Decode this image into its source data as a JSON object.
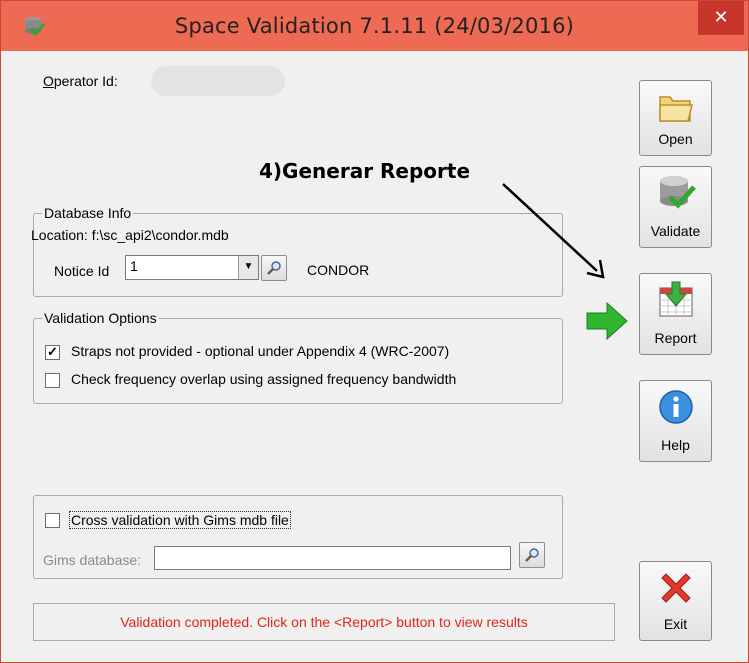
{
  "window": {
    "title": "Space Validation 7.1.11 (24/03/2016)",
    "close_glyph": "✕",
    "app_icon": "database-check-icon"
  },
  "operator": {
    "label_accel": "O",
    "label_rest": "perator Id:",
    "value": ""
  },
  "annotation": {
    "text": "4)Generar Reporte"
  },
  "database_info": {
    "legend": "Database Info",
    "location": "Location: f:\\sc_api2\\condor.mdb",
    "notice_label": "Notice Id",
    "notice_value": "1",
    "notice_name": "CONDOR"
  },
  "validation_options": {
    "legend": "Validation Options",
    "options": [
      {
        "label": "Straps not provided - optional under Appendix 4 (WRC-2007)",
        "checked": true
      },
      {
        "label": "Check frequency overlap using assigned frequency bandwidth",
        "checked": false
      }
    ]
  },
  "cross_validation": {
    "label": "Cross validation with Gims mdb file",
    "checked": false,
    "gims_label": "Gims database:",
    "gims_value": ""
  },
  "status": {
    "text": "Validation completed. Click on the <Report> button to view results",
    "color": "#e0241c"
  },
  "buttons": {
    "open": "Open",
    "validate": "Validate",
    "report": "Report",
    "help": "Help",
    "exit": "Exit"
  },
  "colors": {
    "titlebar": "#ef6a52",
    "close": "#c7362a",
    "arrow_green": "#2fb52f"
  }
}
